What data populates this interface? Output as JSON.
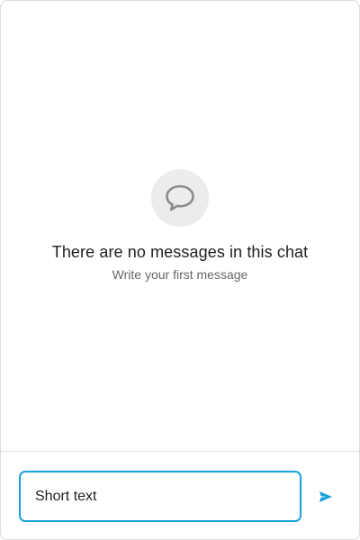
{
  "empty_state": {
    "icon": "chat-bubble-icon",
    "title": "There are no messages in this chat",
    "subtitle": "Write your first message"
  },
  "composer": {
    "input_value": "Short text",
    "send_icon": "send-icon"
  },
  "colors": {
    "accent": "#1aa0d8",
    "icon_background": "#ececec",
    "icon_stroke": "#8a8a8a"
  }
}
